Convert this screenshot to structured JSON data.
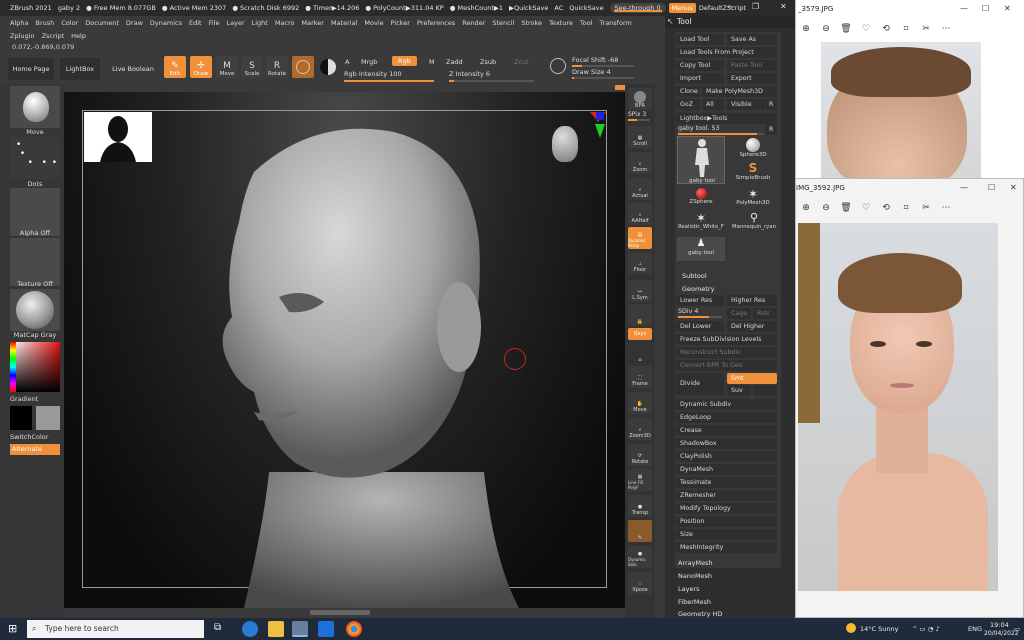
{
  "zbrush": {
    "title_items": [
      "ZBrush 2021",
      "gaby 2",
      "● Free Mem 8.077GB",
      "● Active Mem 2307",
      "● Scratch Disk 6992",
      "● Timer▶14.206",
      "● PolyCount▶311.04 KP",
      "● MeshCount▶1",
      "▶QuickSave",
      "AC",
      "QuickSave"
    ],
    "see_through": "See-through  0",
    "menus": "Menus",
    "default_zscript": "DefaultZScript",
    "menu_row1": [
      "Alpha",
      "Brush",
      "Color",
      "Document",
      "Draw",
      "Dynamics",
      "Edit",
      "File",
      "Layer",
      "Light",
      "Macro",
      "Marker",
      "Material",
      "Movie",
      "Picker",
      "Preferences",
      "Render",
      "Stencil",
      "Stroke",
      "Texture",
      "Tool",
      "Transform"
    ],
    "menu_row2": [
      "Zplugin",
      "Zscript",
      "Help"
    ],
    "coords": "0.072,-0.869,0.079",
    "top": {
      "home": "Home Page",
      "lightbox": "LightBox",
      "live_boolean": "Live Boolean",
      "edit": "Edit",
      "draw": "Draw",
      "move": "Move",
      "scale": "Scale",
      "rotate": "Rotate",
      "a": "A",
      "mrgb": "Mrgb",
      "rgb": "Rgb",
      "m": "M",
      "zadd": "Zadd",
      "zsub": "Zsub",
      "zcut": "Zcut",
      "rgb_intensity": "Rgb Intensity 100",
      "z_intensity": "Z Intensity 6",
      "focal_shift": "Focal Shift -68",
      "draw_size": "Draw Size 4"
    },
    "left": {
      "move": "Move",
      "dots": "Dots",
      "alpha_off": "Alpha Off",
      "texture_off": "Texture Off",
      "matcap": "MatCap Gray",
      "gradient": "Gradient",
      "switchcolor": "SwitchColor",
      "alternate": "Alternate"
    },
    "right_shelf": [
      "BPR",
      "SPix 3",
      "Scroll",
      "Zoom",
      "Actual",
      "AAHalf",
      "Dynamic Persp",
      "Floor",
      "L.Sym",
      "Qxyz",
      "Frame",
      "Move",
      "Zoom3D",
      "Rotate",
      "Line Fill PolyF",
      "Transp",
      "Dynamic Solo",
      "Xpose"
    ],
    "spix": "SPix 3"
  },
  "tool_palette": {
    "title": "Tool",
    "load_tool": "Load Tool",
    "save_as": "Save As",
    "load_from_project": "Load Tools From Project",
    "copy_tool": "Copy Tool",
    "paste_tool": "Paste Tool",
    "import": "Import",
    "export": "Export",
    "clone": "Clone",
    "make_polymesh": "Make PolyMesh3D",
    "goz": "GoZ",
    "all": "All",
    "visible": "Visible",
    "r": "R",
    "lightbox_tools": "Lightbox▶Tools",
    "gaby_tool_slider": "gaby tool. 53",
    "thumbs": [
      "gaby tool",
      "Sphere3D",
      "SimpleBrush",
      "ZSphere",
      "PolyMesh3D",
      "Realistic_White_F",
      "Mannequin_ryan",
      "gaby tool"
    ],
    "subtool": "Subtool",
    "geometry": "Geometry",
    "lower_res": "Lower Res",
    "higher_res": "Higher Res",
    "sdiv": "SDiv 4",
    "cage": "Cage",
    "rstr": "Rstr",
    "del_lower": "Del Lower",
    "del_higher": "Del Higher",
    "freeze": "Freeze SubDivision Levels",
    "reconstruct": "Reconstruct Subdiv",
    "convert_bpr": "Convert BPR To Geo",
    "divide": "Divide",
    "smt": "Smt",
    "suv": "Suv",
    "reluv": "ReUV",
    "geometry_list": [
      "Dynamic Subdiv",
      "EdgeLoop",
      "Crease",
      "ShadowBox",
      "ClayPolish",
      "DynaMesh",
      "Tessimate",
      "ZRemesher",
      "Modify Topology",
      "Position",
      "Size",
      "MeshIntegrity"
    ],
    "more_list": [
      "ArrayMesh",
      "NanoMesh",
      "Layers",
      "FiberMesh",
      "Geometry HD"
    ]
  },
  "photos": {
    "viewer1_title": "_3579.JPG",
    "viewer2_title": "IMG_3592.JPG"
  },
  "taskbar": {
    "search_placeholder": "Type here to search",
    "weather": "14°C  Sunny",
    "lang": "ENG",
    "time": "19:04",
    "date": "20/04/2022"
  }
}
